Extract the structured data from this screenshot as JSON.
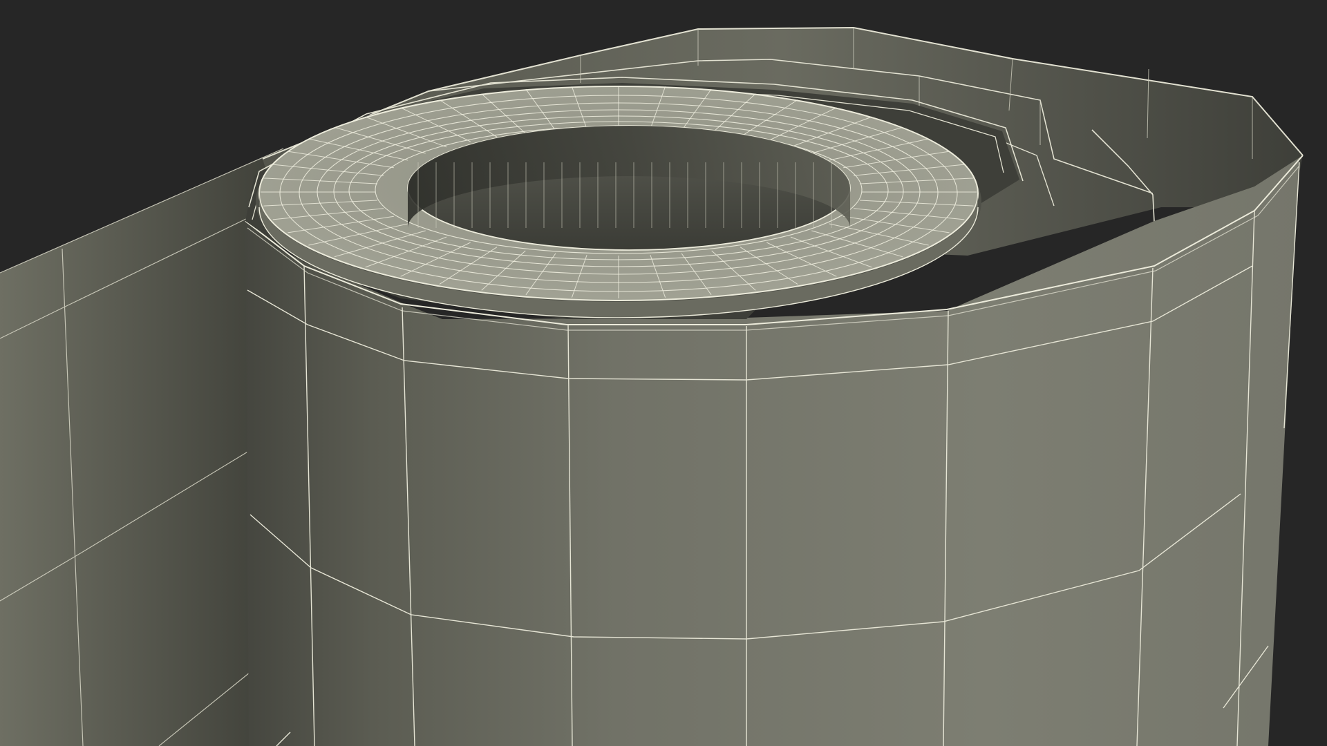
{
  "scene": {
    "background": "#262626",
    "subject": "rolled-sheet-wireframe-render",
    "surface_color_light": "#7b7c70",
    "surface_color_dark": "#4d4e46",
    "wire_color": "#e9e8d8"
  }
}
